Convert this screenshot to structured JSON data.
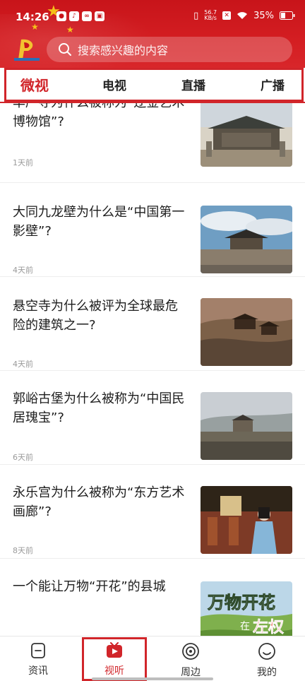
{
  "status_bar": {
    "time": "14:26",
    "net_speed_top": "56.7",
    "net_speed_bottom": "KB/s",
    "battery": "35%"
  },
  "search": {
    "placeholder": "搜索感兴趣的内容"
  },
  "tabs": [
    {
      "label": "微视",
      "active": true
    },
    {
      "label": "电视",
      "active": false
    },
    {
      "label": "直播",
      "active": false
    },
    {
      "label": "广播",
      "active": false
    }
  ],
  "articles": [
    {
      "title": "华严寺为什么被称为“辽金艺术博物馆”?",
      "time": "1天前",
      "image": "temple-thumbnail"
    },
    {
      "title": "大同九龙壁为什么是“中国第一影壁”?",
      "time": "4天前",
      "image": "gate-tower-thumbnail"
    },
    {
      "title": "悬空寺为什么被评为全球最危险的建筑之一?",
      "time": "4天前",
      "image": "hanging-temple-thumbnail"
    },
    {
      "title": "郭峪古堡为什么被称为“中国民居瑰宝”?",
      "time": "6天前",
      "image": "castle-thumbnail"
    },
    {
      "title": "永乐宫为什么被称为“东方艺术画廊”?",
      "time": "8天前",
      "image": "palace-guide-thumbnail"
    },
    {
      "title": "一个能让万物“开花”的县城",
      "time": "",
      "image": "county-flowers-thumbnail"
    }
  ],
  "thumbnail_text": {
    "line1": "万物开花",
    "line2": "在",
    "line3": "左权"
  },
  "bottom_nav": [
    {
      "label": "资讯",
      "icon": "news-icon",
      "active": false
    },
    {
      "label": "视听",
      "icon": "video-play-icon",
      "active": true
    },
    {
      "label": "周边",
      "icon": "nearby-target-icon",
      "active": false
    },
    {
      "label": "我的",
      "icon": "smile-profile-icon",
      "active": false
    }
  ],
  "colors": {
    "brand_red": "#d1252a",
    "header_red": "#c8141a",
    "star_yellow": "#f4c21a"
  }
}
